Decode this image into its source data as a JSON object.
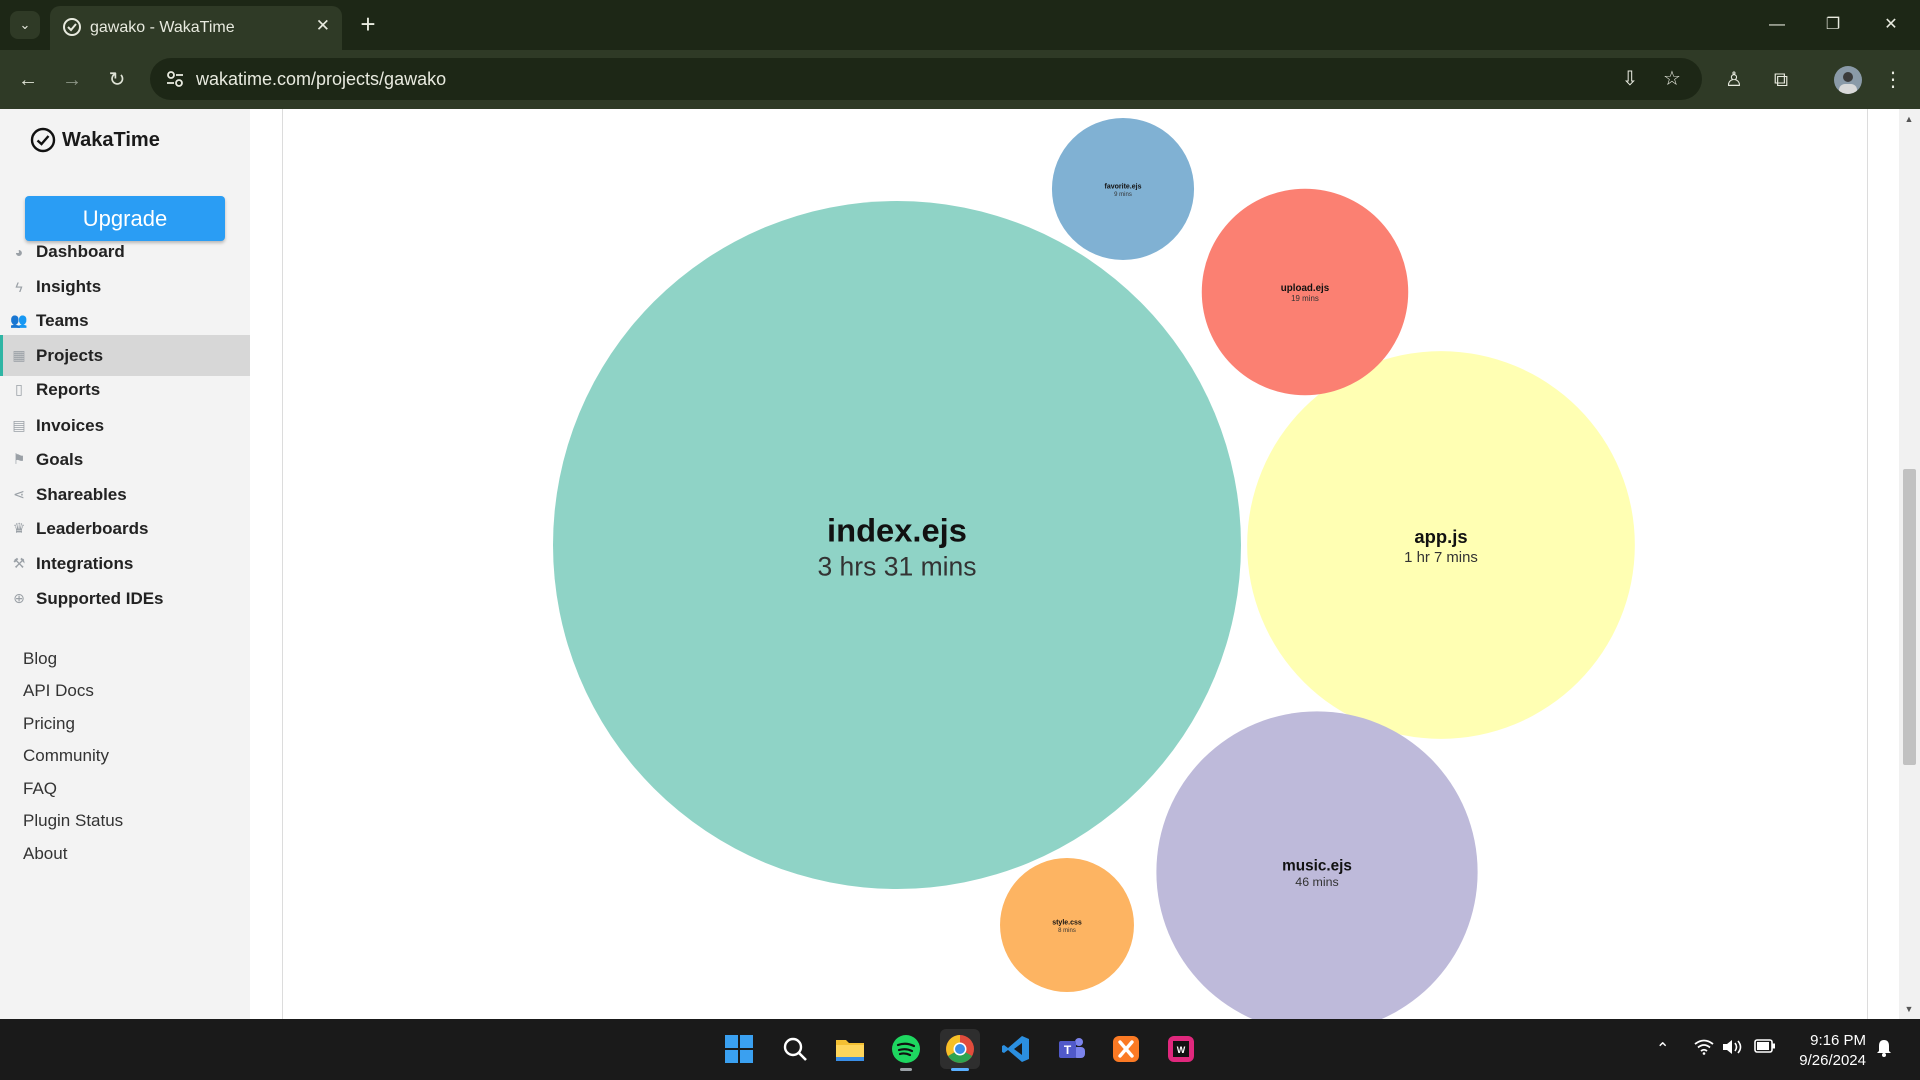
{
  "browser": {
    "tab_title": "gawako - WakaTime",
    "url": "wakatime.com/projects/gawako"
  },
  "sidebar": {
    "brand": "WakaTime",
    "upgrade_label": "Upgrade",
    "nav": [
      {
        "label": "Dashboard",
        "icon": "dashboard-icon"
      },
      {
        "label": "Insights",
        "icon": "bolt-icon"
      },
      {
        "label": "Teams",
        "icon": "users-icon"
      },
      {
        "label": "Projects",
        "icon": "grid-icon",
        "active": true
      },
      {
        "label": "Reports",
        "icon": "pdf-icon"
      },
      {
        "label": "Invoices",
        "icon": "file-icon"
      },
      {
        "label": "Goals",
        "icon": "flag-icon"
      },
      {
        "label": "Shareables",
        "icon": "share-icon"
      },
      {
        "label": "Leaderboards",
        "icon": "trophy-icon"
      },
      {
        "label": "Integrations",
        "icon": "wrench-icon"
      },
      {
        "label": "Supported IDEs",
        "icon": "plus-circle-icon"
      }
    ],
    "footer_links": [
      "Blog",
      "API Docs",
      "Pricing",
      "Community",
      "FAQ",
      "Plugin Status",
      "About"
    ]
  },
  "chart_data": {
    "type": "bubble",
    "series": [
      {
        "name": "index.ejs",
        "time": "3 hrs 31 mins",
        "minutes": 211,
        "color": "#8fd3c6"
      },
      {
        "name": "app.js",
        "time": "1 hr 7 mins",
        "minutes": 67,
        "color": "#ffffb3"
      },
      {
        "name": "music.ejs",
        "time": "46 mins",
        "minutes": 46,
        "color": "#bebada"
      },
      {
        "name": "upload.ejs",
        "time": "19 mins",
        "minutes": 19,
        "color": "#fb8072"
      },
      {
        "name": "favorite.ejs",
        "time": "9 mins",
        "minutes": 9,
        "color": "#80b1d3"
      },
      {
        "name": "style.css",
        "time": "8 mins",
        "minutes": 8,
        "color": "#fdb462"
      }
    ]
  },
  "taskbar": {
    "time": "9:16 PM",
    "date": "9/26/2024"
  }
}
